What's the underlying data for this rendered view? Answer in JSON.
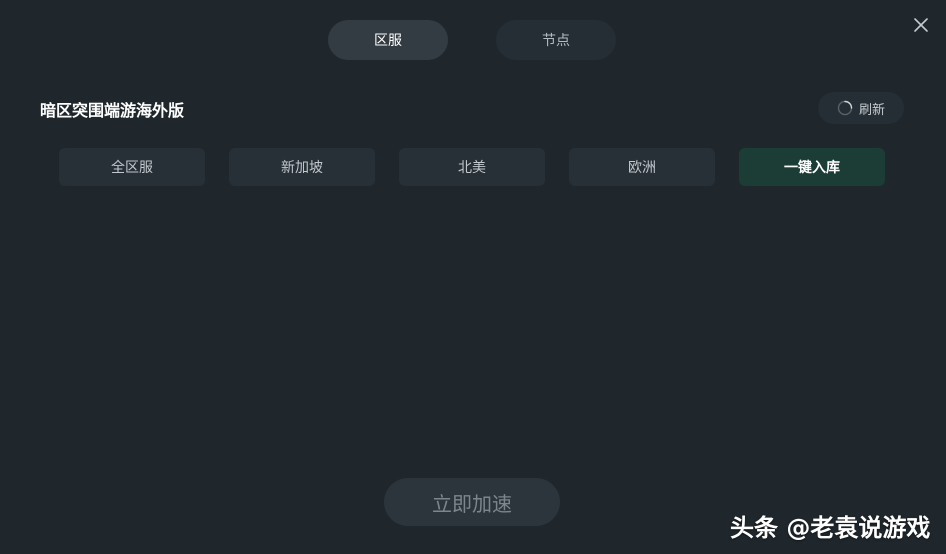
{
  "tabs": [
    {
      "label": "区服",
      "active": true
    },
    {
      "label": "节点",
      "active": false
    }
  ],
  "game": {
    "title": "暗区突围端游海外版"
  },
  "refresh": {
    "label": "刷新",
    "icon": "loading-spinner-icon"
  },
  "regions": [
    {
      "label": "全区服"
    },
    {
      "label": "新加坡"
    },
    {
      "label": "北美"
    },
    {
      "label": "欧洲"
    },
    {
      "label": "一键入库"
    }
  ],
  "accelerate": {
    "label": "立即加速"
  },
  "watermark": {
    "text": "头条 @老袁说游戏"
  },
  "colors": {
    "background": "#1f272d",
    "active_tab": "#323c42",
    "primary_button": "#1c3c36",
    "region_button": "#273036"
  }
}
